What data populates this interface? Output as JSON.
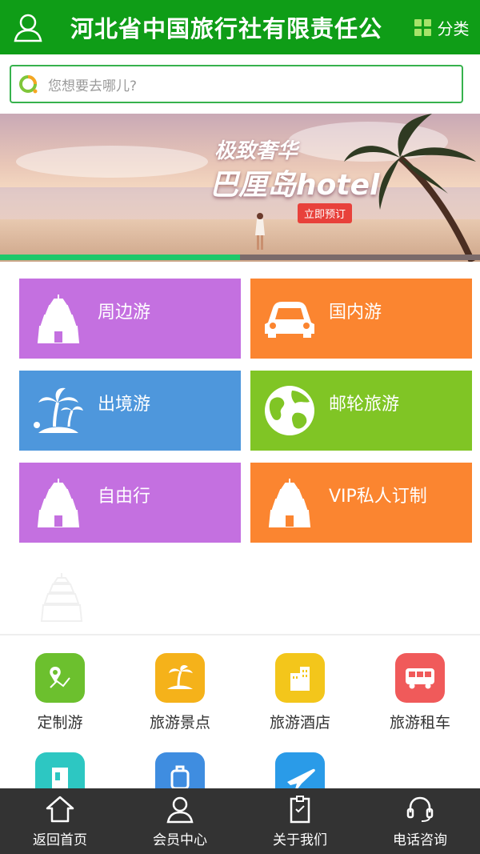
{
  "header": {
    "title": "河北省中国旅行社有限责任公",
    "category_label": "分类",
    "bg_color": "#0f9d17"
  },
  "search": {
    "placeholder": "您想要去哪儿?"
  },
  "banner": {
    "line1": "极致奢华",
    "line2": "巴厘岛hotel",
    "button": "立即预订",
    "progress": 0.5
  },
  "tiles": [
    {
      "label": "周边游",
      "icon": "temple-icon",
      "color": "#c470e0"
    },
    {
      "label": "国内游",
      "icon": "car-icon",
      "color": "#fb8530"
    },
    {
      "label": "出境游",
      "icon": "palm-island-icon",
      "color": "#4e97dc"
    },
    {
      "label": "邮轮旅游",
      "icon": "globe-icon",
      "color": "#80c525"
    },
    {
      "label": "自由行",
      "icon": "temple-icon",
      "color": "#c470e0"
    },
    {
      "label": "VIP私人订制",
      "icon": "temple-icon",
      "color": "#fb8530"
    }
  ],
  "quick_links": [
    {
      "label": "定制游",
      "icon": "map-pin-icon",
      "color": "#6cc02e"
    },
    {
      "label": "旅游景点",
      "icon": "island-icon",
      "color": "#f5b21a"
    },
    {
      "label": "旅游酒店",
      "icon": "hotel-icon",
      "color": "#f3c61b"
    },
    {
      "label": "旅游租车",
      "icon": "bus-icon",
      "color": "#f05a5a"
    },
    {
      "label": "",
      "icon": "guide-icon",
      "color": "#2dc7c2"
    },
    {
      "label": "",
      "icon": "luggage-icon",
      "color": "#3f8de0"
    },
    {
      "label": "",
      "icon": "plane-icon",
      "color": "#2a9be8"
    }
  ],
  "footer": {
    "items": [
      {
        "label": "返回首页",
        "icon": "home-icon"
      },
      {
        "label": "会员中心",
        "icon": "user-icon"
      },
      {
        "label": "关于我们",
        "icon": "clipboard-icon"
      },
      {
        "label": "电话咨询",
        "icon": "headset-icon"
      }
    ]
  }
}
